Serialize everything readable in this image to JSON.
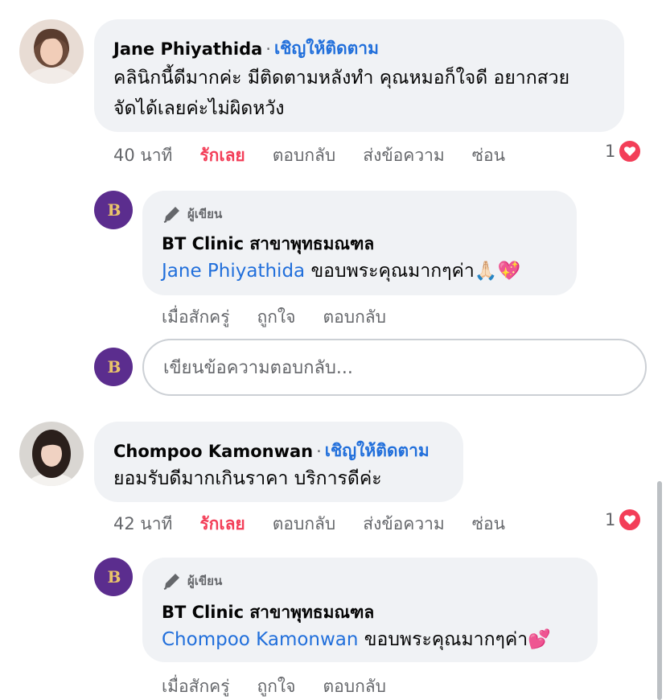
{
  "comments": [
    {
      "author": "Jane Phiyathida",
      "follow_label": "เชิญให้ติดตาม",
      "text_line1": "คลินิกนี้ดีมากค่ะ มีติดตามหลังทำ คุณหมอก็ใจดี อยากสวย",
      "text_line2": "จัดได้เลยค่ะไม่ผิดหวัง",
      "time": "40 นาที",
      "love_label": "รักเลย",
      "reply_label": "ตอบกลับ",
      "message_label": "ส่งข้อความ",
      "hide_label": "ซ่อน",
      "reaction_count": "1",
      "reply": {
        "badge": "ผู้เขียน",
        "page_name": "BT Clinic สาขาพุทธมณฑล",
        "mention": "Jane Phiyathida",
        "text": " ขอบพระคุณมากๆค่า🙏🏻💖",
        "time": "เมื่อสักครู่",
        "like_label": "ถูกใจ",
        "reply_label": "ตอบกลับ"
      },
      "reply_input_placeholder": "เขียนข้อความตอบกลับ..."
    },
    {
      "author": "Chompoo Kamonwan",
      "follow_label": "เชิญให้ติดตาม",
      "text_line1": "ยอมรับดีมากเกินราคา บริการดีค่ะ",
      "time": "42 นาที",
      "love_label": "รักเลย",
      "reply_label": "ตอบกลับ",
      "message_label": "ส่งข้อความ",
      "hide_label": "ซ่อน",
      "reaction_count": "1",
      "reply": {
        "badge": "ผู้เขียน",
        "page_name": "BT Clinic สาขาพุทธมณฑล",
        "mention": "Chompoo Kamonwan",
        "text": " ขอบพระคุณมากๆค่า💕",
        "time": "เมื่อสักครู่",
        "like_label": "ถูกใจ",
        "reply_label": "ตอบกลับ"
      }
    }
  ],
  "page_logo_text": "B",
  "icons": {
    "author_badge": "pencil-icon",
    "reaction": "heart-icon"
  },
  "colors": {
    "link_blue": "#216fdb",
    "love_red": "#f33e58",
    "bubble_bg": "#f0f2f5",
    "meta_gray": "#65676b",
    "logo_purple": "#5b2d8e"
  }
}
